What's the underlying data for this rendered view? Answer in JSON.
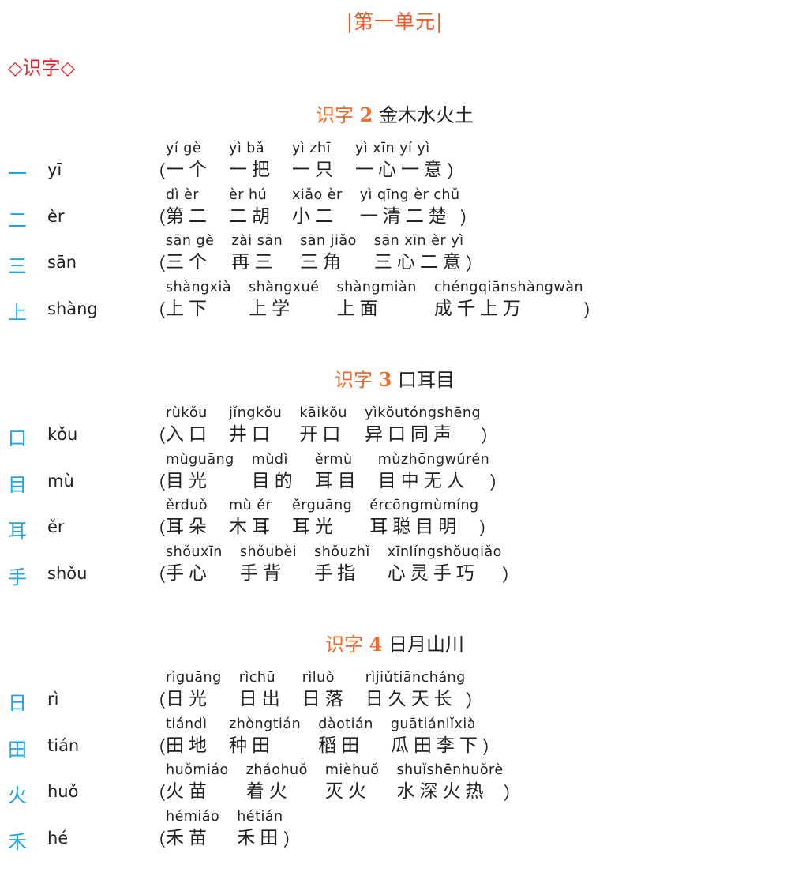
{
  "unit_title": "|第一单元|",
  "section_heading": "◇识字◇",
  "colors": {
    "unit": "#f05a28",
    "section": "#e8202a",
    "lesson_label": "#f26b2a",
    "char": "#1ea6e8",
    "text": "#222222"
  },
  "lessons": [
    {
      "label": "识字",
      "number": "2",
      "chars": "金木水火土",
      "rows": [
        {
          "char": "一",
          "pinyin": "yī",
          "words": [
            {
              "py": "yí gè",
              "hz": "一个"
            },
            {
              "py": "yì bǎ",
              "hz": "一把"
            },
            {
              "py": "yì zhī",
              "hz": "一只"
            },
            {
              "py": "yì xīn yí yì",
              "hz": "一心一意"
            }
          ]
        },
        {
          "char": "二",
          "pinyin": "èr",
          "words": [
            {
              "py": "dì èr",
              "hz": "第二"
            },
            {
              "py": "èr hú",
              "hz": "二胡"
            },
            {
              "py": "xiǎo èr",
              "hz": "小二"
            },
            {
              "py": "yì qīng èr chǔ",
              "hz": "一清二楚"
            }
          ]
        },
        {
          "char": "三",
          "pinyin": "sān",
          "words": [
            {
              "py": "sān gè",
              "hz": "三个"
            },
            {
              "py": "zài sān",
              "hz": "再三"
            },
            {
              "py": "sān jiǎo",
              "hz": "三角"
            },
            {
              "py": "sān xīn èr yì",
              "hz": "三心二意"
            }
          ]
        },
        {
          "char": "上",
          "pinyin": "shàng",
          "words": [
            {
              "py": "shàngxià",
              "hz": "上下"
            },
            {
              "py": "shàngxué",
              "hz": "上学"
            },
            {
              "py": "shàngmiàn",
              "hz": "上面"
            },
            {
              "py": "chéngqiānshàngwàn",
              "hz": "成千上万"
            }
          ]
        }
      ]
    },
    {
      "label": "识字",
      "number": "3",
      "chars": "口耳目",
      "rows": [
        {
          "char": "口",
          "pinyin": "kǒu",
          "words": [
            {
              "py": "rùkǒu",
              "hz": "入口"
            },
            {
              "py": "jǐngkǒu",
              "hz": "井口"
            },
            {
              "py": "kāikǒu",
              "hz": "开口"
            },
            {
              "py": "yìkǒutóngshēng",
              "hz": "异口同声"
            }
          ]
        },
        {
          "char": "目",
          "pinyin": "mù",
          "words": [
            {
              "py": "mùguāng",
              "hz": "目光"
            },
            {
              "py": "mùdì",
              "hz": "目的"
            },
            {
              "py": "ěrmù",
              "hz": "耳目"
            },
            {
              "py": "mùzhōngwúrén",
              "hz": "目中无人"
            }
          ]
        },
        {
          "char": "耳",
          "pinyin": "ěr",
          "words": [
            {
              "py": "ěrduǒ",
              "hz": "耳朵"
            },
            {
              "py": "mù ěr",
              "hz": "木耳"
            },
            {
              "py": "ěrguāng",
              "hz": "耳光"
            },
            {
              "py": "ěrcōngmùmíng",
              "hz": "耳聪目明"
            }
          ]
        },
        {
          "char": "手",
          "pinyin": "shǒu",
          "words": [
            {
              "py": "shǒuxīn",
              "hz": "手心"
            },
            {
              "py": "shǒubèi",
              "hz": "手背"
            },
            {
              "py": "shǒuzhǐ",
              "hz": "手指"
            },
            {
              "py": "xīnlíngshǒuqiǎo",
              "hz": "心灵手巧"
            }
          ]
        }
      ]
    },
    {
      "label": "识字",
      "number": "4",
      "chars": "日月山川",
      "rows": [
        {
          "char": "日",
          "pinyin": "rì",
          "words": [
            {
              "py": "rìguāng",
              "hz": "日光"
            },
            {
              "py": "rìchū",
              "hz": "日出"
            },
            {
              "py": "rìluò",
              "hz": "日落"
            },
            {
              "py": "rìjiǔtiāncháng",
              "hz": "日久天长"
            }
          ]
        },
        {
          "char": "田",
          "pinyin": "tián",
          "words": [
            {
              "py": "tiándì",
              "hz": "田地"
            },
            {
              "py": "zhòngtián",
              "hz": "种田"
            },
            {
              "py": "dàotián",
              "hz": "稻田"
            },
            {
              "py": "guātiánlǐxià",
              "hz": "瓜田李下"
            }
          ]
        },
        {
          "char": "火",
          "pinyin": "huǒ",
          "words": [
            {
              "py": "huǒmiáo",
              "hz": "火苗"
            },
            {
              "py": "zháohuǒ",
              "hz": "着火"
            },
            {
              "py": "mièhuǒ",
              "hz": "灭火"
            },
            {
              "py": "shuǐshēnhuǒrè",
              "hz": "水深火热"
            }
          ]
        },
        {
          "char": "禾",
          "pinyin": "hé",
          "words": [
            {
              "py": "hémiáo",
              "hz": "禾苗"
            },
            {
              "py": "hétián",
              "hz": "禾田"
            }
          ]
        }
      ]
    }
  ],
  "open_paren": "（",
  "close_paren": "）"
}
